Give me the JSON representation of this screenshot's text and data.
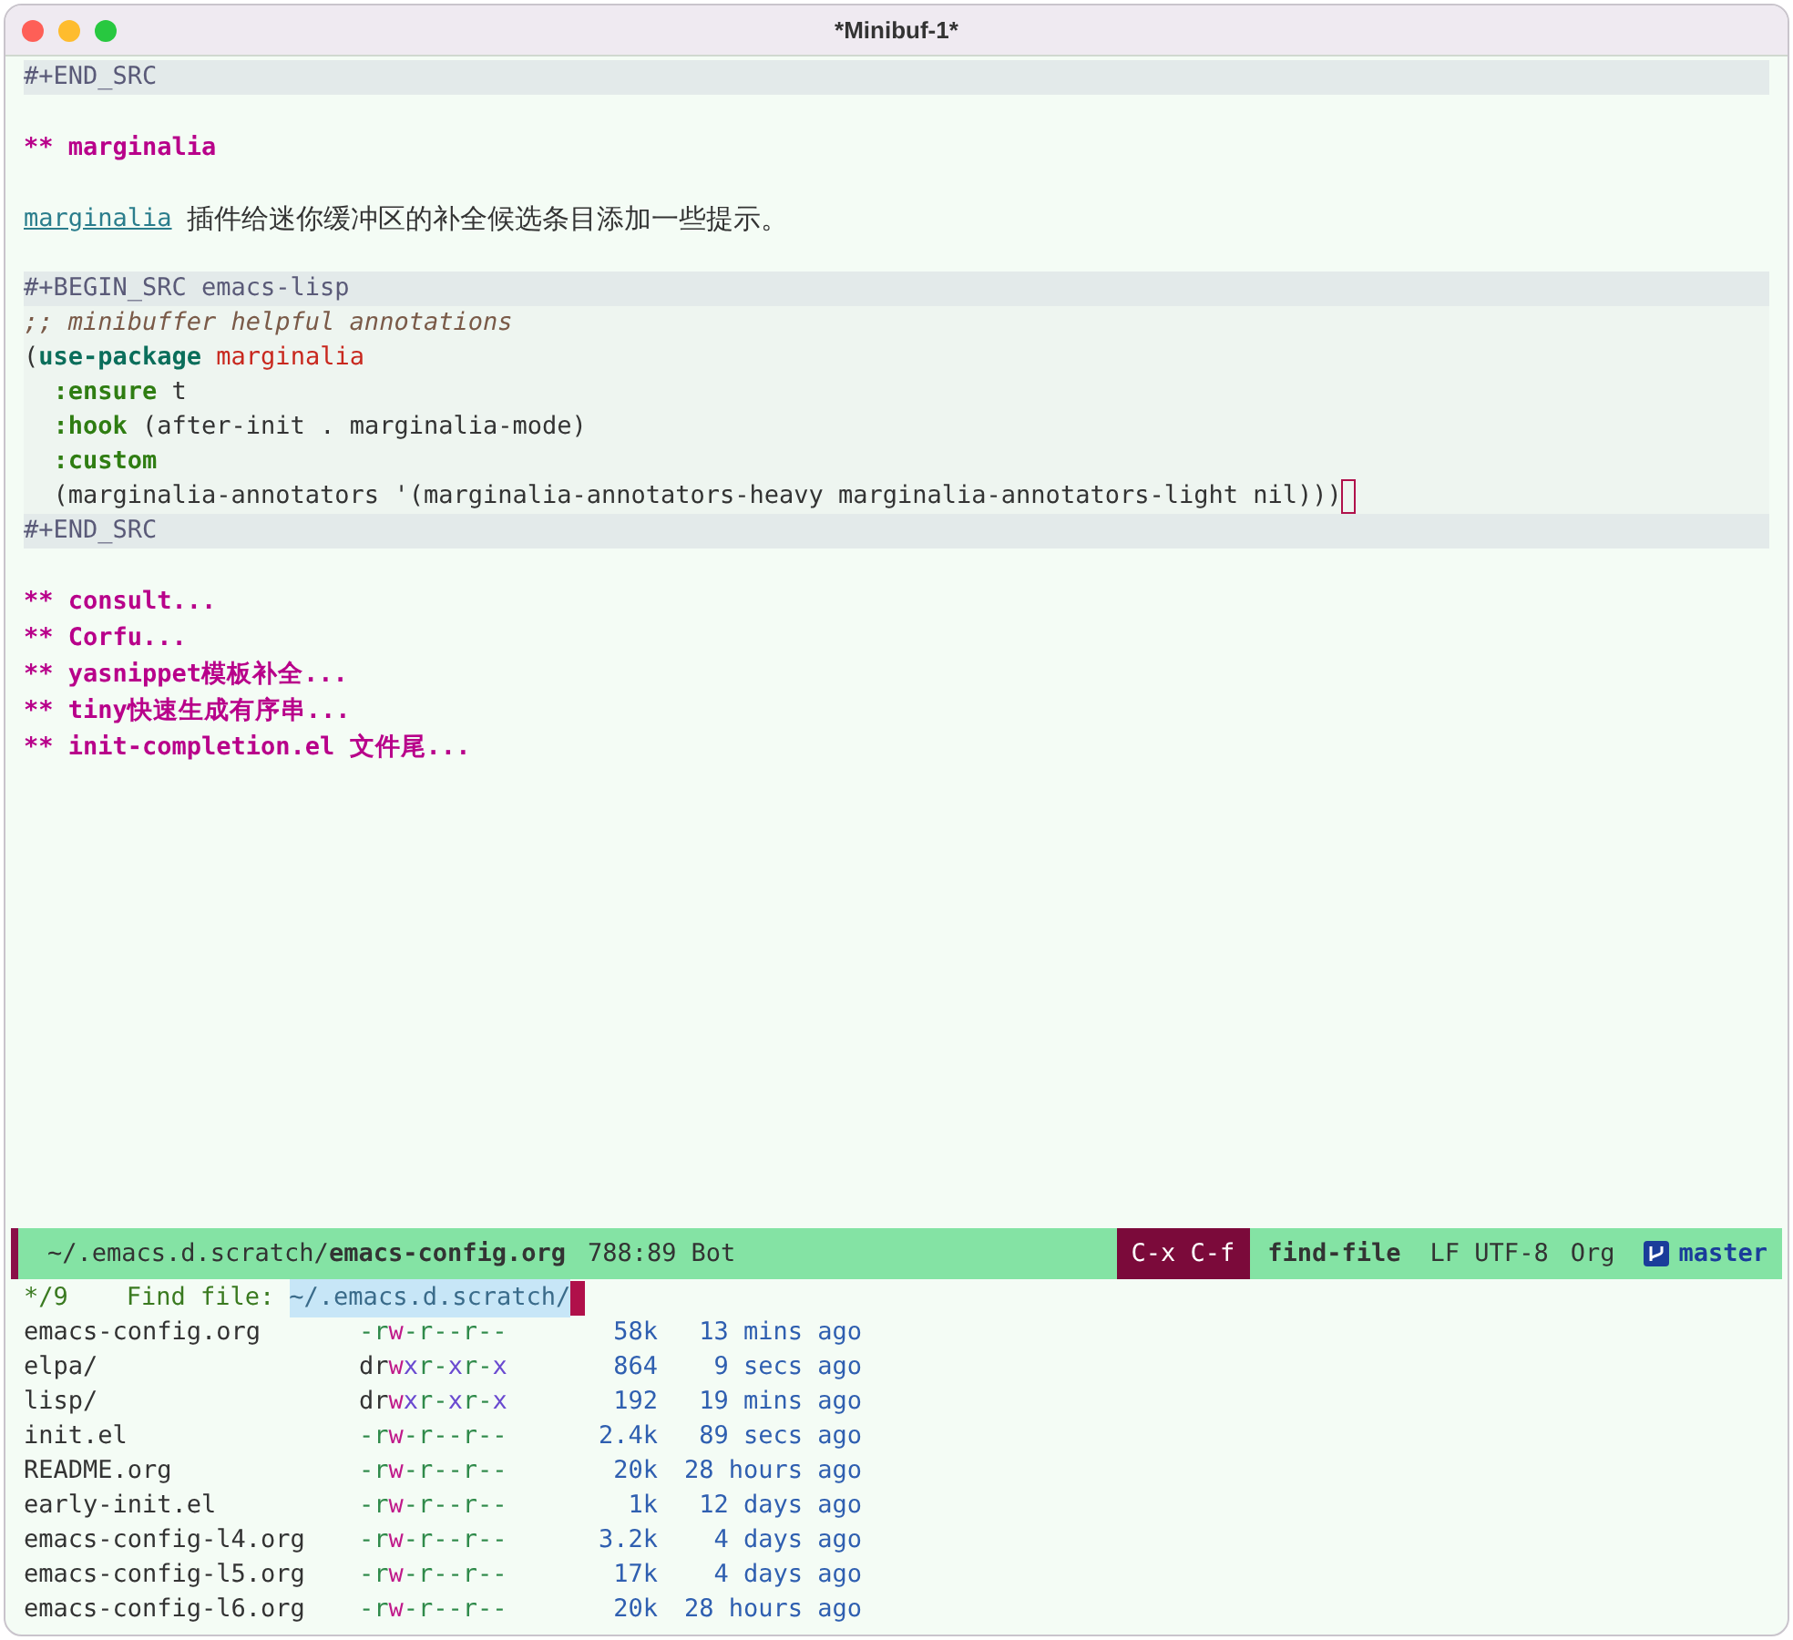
{
  "window": {
    "title": "*Minibuf-1*"
  },
  "buffer": {
    "lines": [
      {
        "kind": "delimiter",
        "text": "#+END_SRC"
      },
      {
        "kind": "blank"
      },
      {
        "kind": "heading",
        "marker": "**",
        "text": "marginalia"
      },
      {
        "kind": "blank"
      },
      {
        "kind": "prose",
        "link": "marginalia",
        "text": "插件给迷你缓冲区的补全候选条目添加一些提示。"
      },
      {
        "kind": "blank"
      },
      {
        "kind": "delimiter",
        "text": "#+BEGIN_SRC emacs-lisp"
      },
      {
        "kind": "code",
        "segments": [
          {
            "text": ";; minibuffer helpful annotations",
            "kind": "comment"
          }
        ]
      },
      {
        "kind": "code",
        "segments": [
          {
            "text": "(",
            "kind": "plain"
          },
          {
            "text": "use-package",
            "kind": "macro"
          },
          {
            "text": " marginalia",
            "kind": "name"
          }
        ]
      },
      {
        "kind": "code",
        "segments": [
          {
            "text": "  :ensure",
            "kind": "keyword"
          },
          {
            "text": " t",
            "kind": "plain"
          }
        ]
      },
      {
        "kind": "code",
        "segments": [
          {
            "text": "  :hook",
            "kind": "keyword"
          },
          {
            "text": " (after-init . marginalia-mode)",
            "kind": "plain"
          }
        ]
      },
      {
        "kind": "code",
        "segments": [
          {
            "text": "  :custom",
            "kind": "keyword"
          }
        ]
      },
      {
        "kind": "code",
        "cursor": true,
        "segments": [
          {
            "text": "  (marginalia-annotators '(marginalia-annotators-heavy marginalia-annotators-light nil)))",
            "kind": "plain"
          }
        ]
      },
      {
        "kind": "delimiter",
        "text": "#+END_SRC"
      },
      {
        "kind": "blank"
      },
      {
        "kind": "heading",
        "marker": "**",
        "text": "consult..."
      },
      {
        "kind": "heading",
        "marker": "**",
        "text": "Corfu..."
      },
      {
        "kind": "heading",
        "marker": "**",
        "text": "yasnippet模板补全..."
      },
      {
        "kind": "heading",
        "marker": "**",
        "text": "tiny快速生成有序串..."
      },
      {
        "kind": "heading",
        "marker": "**",
        "text": "init-completion.el 文件尾..."
      }
    ]
  },
  "mode_line": {
    "path": "~/.emacs.d.scratch/",
    "file": "emacs-config.org",
    "position": "788:89",
    "scroll": "Bot",
    "keys": "C-x C-f",
    "command": "find-file",
    "encoding": "LF UTF-8",
    "mode": "Org",
    "branch": "master"
  },
  "minibuffer": {
    "count": "*/9",
    "prompt": "Find file:",
    "input": "~/.emacs.d.scratch/"
  },
  "candidates": [
    {
      "name": "emacs-config.org",
      "perms": [
        {
          "text": "-r",
          "kind": "read"
        },
        {
          "text": "w",
          "kind": "write"
        },
        {
          "text": "-r--r--",
          "kind": "read"
        }
      ],
      "size": "58k",
      "time": "13 mins ago"
    },
    {
      "name": "elpa/",
      "perms": [
        {
          "text": "dr",
          "kind": "dir"
        },
        {
          "text": "w",
          "kind": "write"
        },
        {
          "text": "x",
          "kind": "exec"
        },
        {
          "text": "r-",
          "kind": "read"
        },
        {
          "text": "x",
          "kind": "exec"
        },
        {
          "text": "r-",
          "kind": "read"
        },
        {
          "text": "x",
          "kind": "exec"
        }
      ],
      "size": "864",
      "time": "9 secs ago"
    },
    {
      "name": "lisp/",
      "perms": [
        {
          "text": "dr",
          "kind": "dir"
        },
        {
          "text": "w",
          "kind": "write"
        },
        {
          "text": "x",
          "kind": "exec"
        },
        {
          "text": "r-",
          "kind": "read"
        },
        {
          "text": "x",
          "kind": "exec"
        },
        {
          "text": "r-",
          "kind": "read"
        },
        {
          "text": "x",
          "kind": "exec"
        }
      ],
      "size": "192",
      "time": "19 mins ago"
    },
    {
      "name": "init.el",
      "perms": [
        {
          "text": "-r",
          "kind": "read"
        },
        {
          "text": "w",
          "kind": "write"
        },
        {
          "text": "-r--r--",
          "kind": "read"
        }
      ],
      "size": "2.4k",
      "time": "89 secs ago"
    },
    {
      "name": "README.org",
      "perms": [
        {
          "text": "-r",
          "kind": "read"
        },
        {
          "text": "w",
          "kind": "write"
        },
        {
          "text": "-r--r--",
          "kind": "read"
        }
      ],
      "size": "20k",
      "time": "28 hours ago"
    },
    {
      "name": "early-init.el",
      "perms": [
        {
          "text": "-r",
          "kind": "read"
        },
        {
          "text": "w",
          "kind": "write"
        },
        {
          "text": "-r--r--",
          "kind": "read"
        }
      ],
      "size": "1k",
      "time": "12 days ago"
    },
    {
      "name": "emacs-config-l4.org",
      "perms": [
        {
          "text": "-r",
          "kind": "read"
        },
        {
          "text": "w",
          "kind": "write"
        },
        {
          "text": "-r--r--",
          "kind": "read"
        }
      ],
      "size": "3.2k",
      "time": "4 days ago"
    },
    {
      "name": "emacs-config-l5.org",
      "perms": [
        {
          "text": "-r",
          "kind": "read"
        },
        {
          "text": "w",
          "kind": "write"
        },
        {
          "text": "-r--r--",
          "kind": "read"
        }
      ],
      "size": "17k",
      "time": "4 days ago"
    },
    {
      "name": "emacs-config-l6.org",
      "perms": [
        {
          "text": "-r",
          "kind": "read"
        },
        {
          "text": "w",
          "kind": "write"
        },
        {
          "text": "-r--r--",
          "kind": "read"
        }
      ],
      "size": "20k",
      "time": "28 hours ago"
    }
  ]
}
